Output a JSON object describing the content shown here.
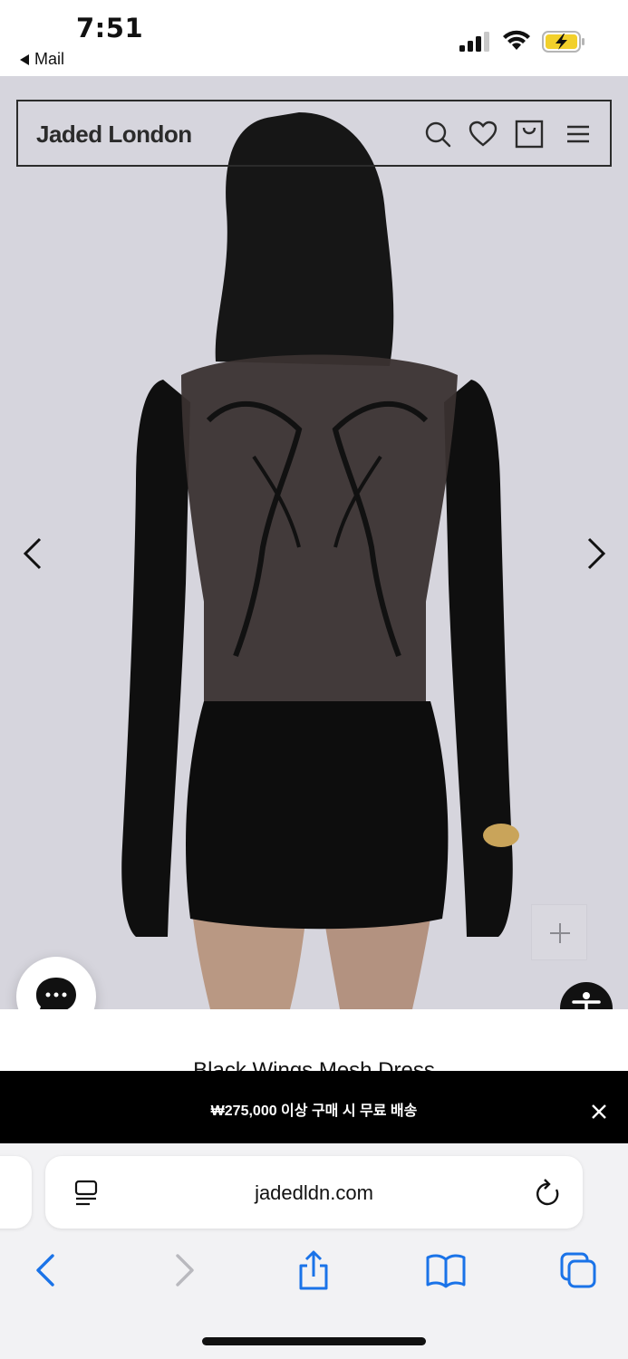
{
  "status_bar": {
    "time": "7:51",
    "back_app": "Mail"
  },
  "site_header": {
    "brand": "Jaded London",
    "icons": [
      "search-icon",
      "heart-icon",
      "shopping-bag-icon",
      "menu-icon"
    ]
  },
  "product": {
    "title": "Black Wings Mesh Dress"
  },
  "promo": {
    "text": "₩275,000 이상 구매 시 무료 배송"
  },
  "browser": {
    "url": "jadedldn.com"
  },
  "colors": {
    "hero_background": "#d6d5dd",
    "promo_background": "#000000",
    "safari_link_blue": "#1a73e8"
  }
}
